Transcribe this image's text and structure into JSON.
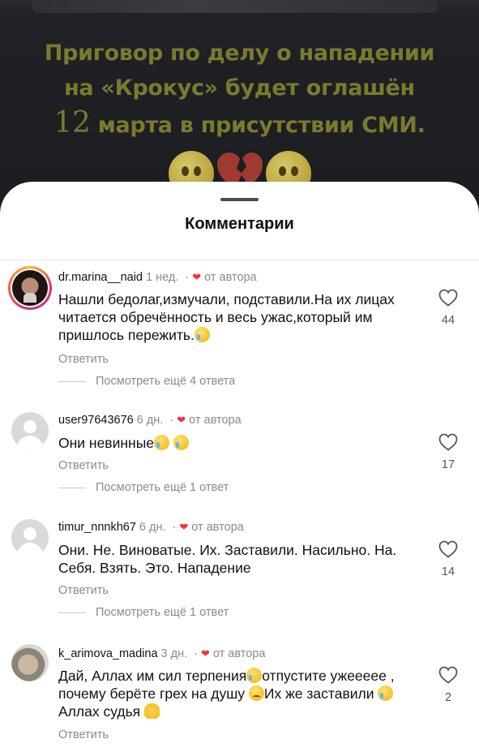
{
  "post": {
    "headline_line1": "Приговор по делу о нападении",
    "headline_line2": "на «Крокус» будет оглашён",
    "headline_line3_num": "12",
    "headline_line3_rest": " марта в присутствии СМИ.",
    "accent_color": "#7b7a2f",
    "emojis": [
      "pleading-face-emoji",
      "broken-heart-emoji",
      "pleading-face-emoji"
    ]
  },
  "sheet": {
    "title": "Комментарии"
  },
  "comments": [
    {
      "username": "dr.marina__naid",
      "time": "1 нед.",
      "author_liked": "от автора",
      "text": "Нашли бедолаг,измучали, подставили.На их лицах читается обречённость и весь ужас,который им пришлось пережить.",
      "reply": "Ответить",
      "more_replies": "Посмотреть ещё 4 ответа",
      "likes": "44",
      "avatar": "story-ring-photo"
    },
    {
      "username": "user97643676",
      "time": "6 дн.",
      "author_liked": "от автора",
      "text": "Они невинные",
      "reply": "Ответить",
      "more_replies": "Посмотреть ещё 1 ответ",
      "likes": "17",
      "avatar": "default-avatar"
    },
    {
      "username": "timur_nnnkh67",
      "time": "6 дн.",
      "author_liked": "от автора",
      "text": "Они. Не. Виноватые. Их. Заставили. Насильно. На. Себя. Взять.  Это. Нападение",
      "reply": "Ответить",
      "more_replies": "Посмотреть ещё 1 ответ",
      "likes": "14",
      "avatar": "default-avatar"
    },
    {
      "username": "k_arimova_madina",
      "time": "3 дн.",
      "author_liked": "от автора",
      "text_part1": "Дай, Аллах им сил терпения",
      "text_part2": "отпустите ужеееее , почему  берёте грех на душу ",
      "text_part3": "Их же заставили ",
      "text_part4": " Аллах судья ",
      "reply": "Ответить",
      "likes": "2",
      "avatar": "photo-avatar"
    }
  ],
  "colors": {
    "heart": "#ff2a3f",
    "muted_text": "#8a8a8a",
    "sheet_bg": "#ffffff",
    "post_bg": "#1c1e21"
  }
}
